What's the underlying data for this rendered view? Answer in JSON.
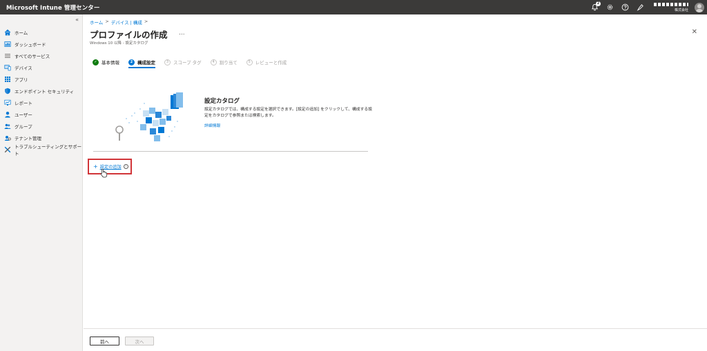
{
  "app": {
    "title": "Microsoft Intune 管理センター"
  },
  "topbar": {
    "notifications_count": "2",
    "account_org": "株式会社",
    "icons": [
      "notification-icon",
      "gear-icon",
      "help-icon",
      "feedback-icon",
      "avatar"
    ]
  },
  "sidebar": {
    "collapse_glyph": "«",
    "items": [
      {
        "label": "ホーム",
        "icon": "home-icon"
      },
      {
        "label": "ダッシュボード",
        "icon": "dashboard-icon"
      },
      {
        "label": "すべてのサービス",
        "icon": "all-services-icon"
      },
      {
        "label": "デバイス",
        "icon": "devices-icon"
      },
      {
        "label": "アプリ",
        "icon": "apps-icon"
      },
      {
        "label": "エンドポイント セキュリティ",
        "icon": "shield-icon"
      },
      {
        "label": "レポート",
        "icon": "reports-icon"
      },
      {
        "label": "ユーザー",
        "icon": "user-icon"
      },
      {
        "label": "グループ",
        "icon": "groups-icon"
      },
      {
        "label": "テナント管理",
        "icon": "tenant-icon"
      },
      {
        "label": "トラブルシューティングとサポート",
        "icon": "wrench-icon"
      }
    ]
  },
  "breadcrumb": {
    "items": [
      "ホーム",
      "デバイス | 構成"
    ],
    "separator": ">"
  },
  "page": {
    "title": "プロファイルの作成",
    "more": "...",
    "subtitle": "Windows 10 以降 - 設定カタログ",
    "close": "✕"
  },
  "wizard": {
    "steps": [
      {
        "num": "✓",
        "label": "基本情報",
        "state": "done"
      },
      {
        "num": "2",
        "label": "構成設定",
        "state": "active"
      },
      {
        "num": "3",
        "label": "スコープ タグ",
        "state": "pending"
      },
      {
        "num": "4",
        "label": "割り当て",
        "state": "pending"
      },
      {
        "num": "5",
        "label": "レビューと作成",
        "state": "pending"
      }
    ]
  },
  "catalog": {
    "title": "設定カタログ",
    "description": "設定カタログでは、構成する設定を選択できます。[設定の追加] をクリックして、構成する設定をカタログで参照または検索します。",
    "link": "詳細情報"
  },
  "actions": {
    "add_plus": "+",
    "add_setting": "設定の追加",
    "info": "i"
  },
  "footer": {
    "prev": "前へ",
    "next": "次へ"
  },
  "colors": {
    "accent": "#0078d4",
    "topbar": "#3b3a39",
    "highlight": "#d13438",
    "done": "#107c10"
  }
}
